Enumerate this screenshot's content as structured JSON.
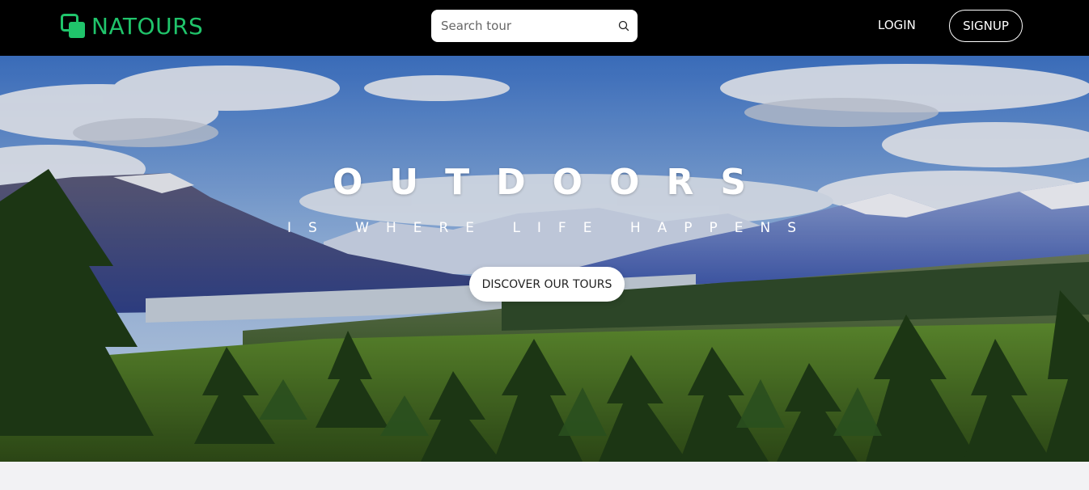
{
  "nav": {
    "brand": "NATOURS",
    "search_placeholder": "Search tour",
    "login": "LOGIN",
    "signup": "SIGNUP"
  },
  "hero": {
    "title": "OUTDOORS",
    "subtitle": "IS WHERE LIFE HAPPENS",
    "cta": "DISCOVER OUR TOURS"
  },
  "colors": {
    "brand": "#20c46b",
    "navbar_bg": "#000000",
    "page_bg": "#f2f2f4"
  },
  "icons": [
    "logo-icon",
    "search-icon"
  ]
}
